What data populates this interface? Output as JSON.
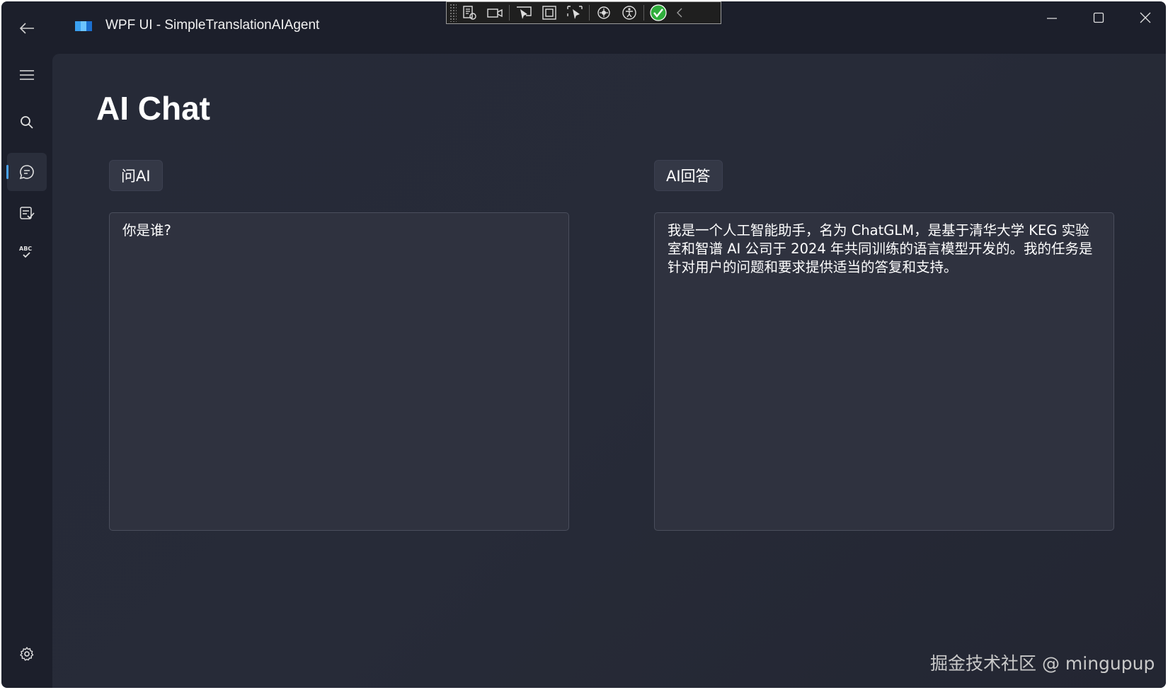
{
  "window": {
    "title": "WPF UI - SimpleTranslationAIAgent"
  },
  "debug_toolbar": {
    "buttons": [
      "live-visual-tree-icon",
      "record-icon",
      "select-element-icon",
      "display-layout-adorners-icon",
      "track-focused-element-icon",
      "hot-reload-icon",
      "accessibility-icon",
      "binding-check-icon",
      "collapse-icon"
    ]
  },
  "sidebar": {
    "items": [
      {
        "name": "menu",
        "icon": "hamburger-icon"
      },
      {
        "name": "search",
        "icon": "search-icon"
      },
      {
        "name": "chat",
        "icon": "chat-icon",
        "active": true
      },
      {
        "name": "translate",
        "icon": "translate-icon"
      },
      {
        "name": "spellcheck",
        "icon": "spellcheck-icon"
      },
      {
        "name": "settings",
        "icon": "gear-icon"
      }
    ],
    "accent_color": "#4aa3f5"
  },
  "main": {
    "page_title": "AI Chat",
    "ask_label": "问AI",
    "answer_label": "AI回答",
    "ask_text": "你是谁?",
    "answer_text": "我是一个人工智能助手，名为 ChatGLM，是基于清华大学 KEG 实验室和智谱 AI 公司于 2024 年共同训练的语言模型开发的。我的任务是针对用户的问题和要求提供适当的答复和支持。"
  },
  "watermark": "掘金技术社区 @ mingupup"
}
